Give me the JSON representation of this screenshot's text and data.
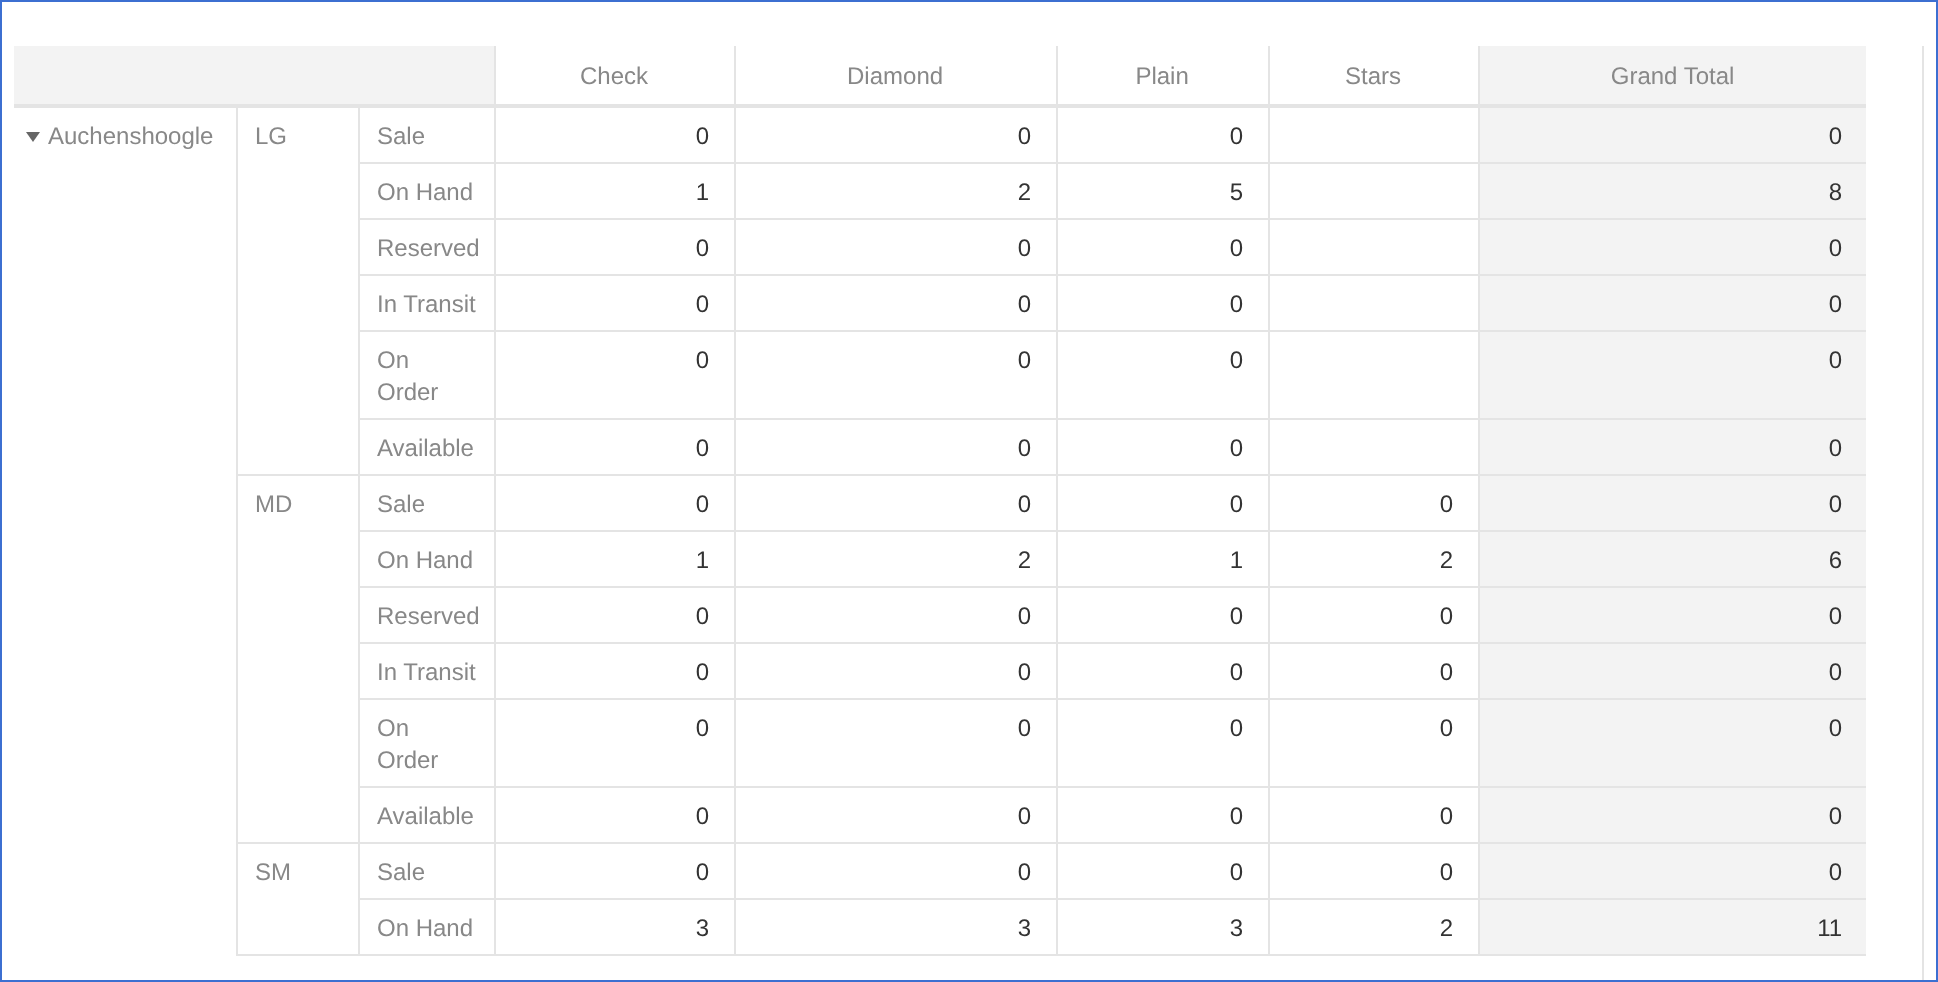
{
  "columns": [
    "Check",
    "Diamond",
    "Plain",
    "Stars",
    "Grand Total"
  ],
  "groups": [
    {
      "name": "Auchenshoogle",
      "expanded": true,
      "sizes": [
        {
          "name": "LG",
          "rows": [
            {
              "label": "Sale",
              "values": [
                "0",
                "0",
                "0"
              ],
              "grand_total": "0"
            },
            {
              "label": "On Hand",
              "values": [
                "1",
                "2",
                "5"
              ],
              "grand_total": "8"
            },
            {
              "label": "Reserved",
              "values": [
                "0",
                "0",
                "0"
              ],
              "grand_total": "0"
            },
            {
              "label": "In Transit",
              "values": [
                "0",
                "0",
                "0"
              ],
              "grand_total": "0"
            },
            {
              "label": "On\nOrder",
              "values": [
                "0",
                "0",
                "0"
              ],
              "grand_total": "0"
            },
            {
              "label": "Available",
              "values": [
                "0",
                "0",
                "0"
              ],
              "grand_total": "0"
            }
          ]
        },
        {
          "name": "MD",
          "rows": [
            {
              "label": "Sale",
              "values": [
                "0",
                "0",
                "0",
                "0"
              ],
              "grand_total": "0"
            },
            {
              "label": "On Hand",
              "values": [
                "1",
                "2",
                "1",
                "2"
              ],
              "grand_total": "6"
            },
            {
              "label": "Reserved",
              "values": [
                "0",
                "0",
                "0",
                "0"
              ],
              "grand_total": "0"
            },
            {
              "label": "In Transit",
              "values": [
                "0",
                "0",
                "0",
                "0"
              ],
              "grand_total": "0"
            },
            {
              "label": "On\nOrder",
              "values": [
                "0",
                "0",
                "0",
                "0"
              ],
              "grand_total": "0"
            },
            {
              "label": "Available",
              "values": [
                "0",
                "0",
                "0",
                "0"
              ],
              "grand_total": "0"
            }
          ]
        },
        {
          "name": "SM",
          "rows": [
            {
              "label": "Sale",
              "values": [
                "0",
                "0",
                "0",
                "0"
              ],
              "grand_total": "0"
            },
            {
              "label": "On Hand",
              "values": [
                "3",
                "3",
                "3",
                "2"
              ],
              "grand_total": "11"
            }
          ]
        }
      ]
    }
  ]
}
